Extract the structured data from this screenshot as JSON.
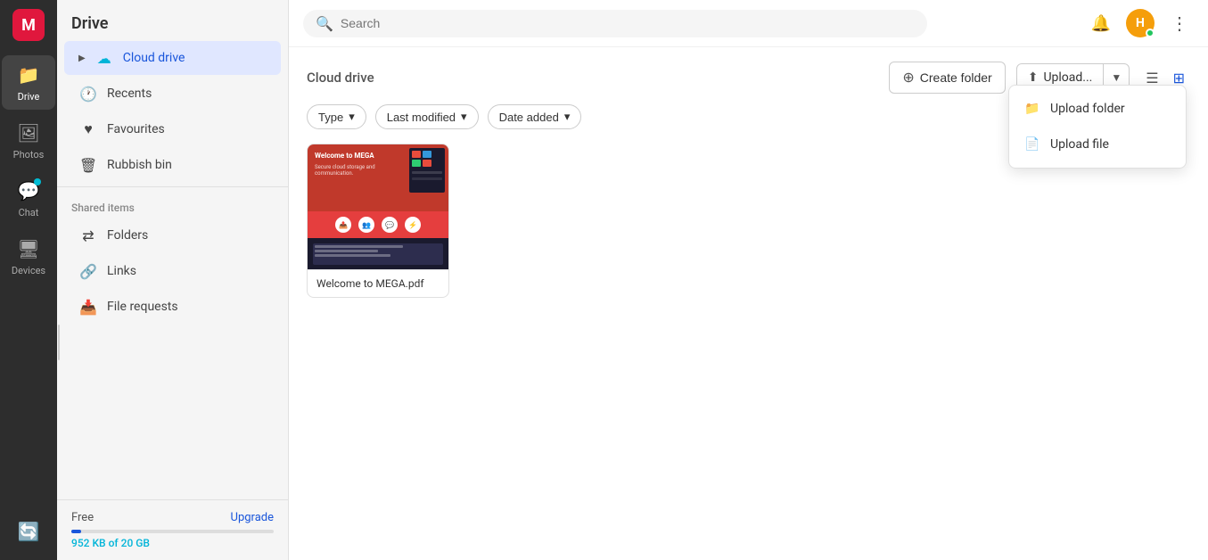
{
  "app": {
    "title": "Drive"
  },
  "nav_rail": {
    "logo_letter": "M",
    "items": [
      {
        "id": "drive",
        "label": "Drive",
        "icon": "📁",
        "active": true
      },
      {
        "id": "photos",
        "label": "Photos",
        "icon": "🖼",
        "active": false
      },
      {
        "id": "chat",
        "label": "Chat",
        "icon": "💬",
        "active": false,
        "has_dot": true
      },
      {
        "id": "devices",
        "label": "Devices",
        "icon": "🖥",
        "active": false
      }
    ],
    "bottom_item": {
      "id": "backup",
      "label": "",
      "icon": "🔄"
    }
  },
  "sidebar": {
    "title": "Drive",
    "cloud_drive_label": "Cloud drive",
    "nav_items": [
      {
        "id": "recents",
        "label": "Recents",
        "icon": "🕐"
      },
      {
        "id": "favourites",
        "label": "Favourites",
        "icon": "♥"
      },
      {
        "id": "rubbish",
        "label": "Rubbish bin",
        "icon": "🗑"
      }
    ],
    "shared_section_label": "Shared items",
    "shared_items": [
      {
        "id": "folders",
        "label": "Folders",
        "icon": "⇄"
      },
      {
        "id": "links",
        "label": "Links",
        "icon": "🔄"
      },
      {
        "id": "file_requests",
        "label": "File requests",
        "icon": "📥"
      }
    ],
    "storage": {
      "free_label": "Free",
      "upgrade_label": "Upgrade",
      "used_kb": "952 KB",
      "total": "20 GB",
      "used_text_prefix": "",
      "used_text_suffix": " of 20 GB",
      "fill_percent": 5
    }
  },
  "topbar": {
    "search_placeholder": "Search"
  },
  "content": {
    "breadcrumb": "Cloud drive",
    "create_folder_label": "Create folder",
    "upload_label": "Upload...",
    "filters": [
      {
        "label": "Type",
        "id": "type"
      },
      {
        "label": "Last modified",
        "id": "last_modified"
      },
      {
        "label": "Date added",
        "id": "date_added"
      }
    ],
    "files": [
      {
        "id": "welcome-mega",
        "name": "Welcome to MEGA.pdf"
      }
    ]
  },
  "dropdown": {
    "items": [
      {
        "id": "upload-folder",
        "label": "Upload folder",
        "icon": "📁"
      },
      {
        "id": "upload-file",
        "label": "Upload file",
        "icon": "📄"
      }
    ]
  }
}
